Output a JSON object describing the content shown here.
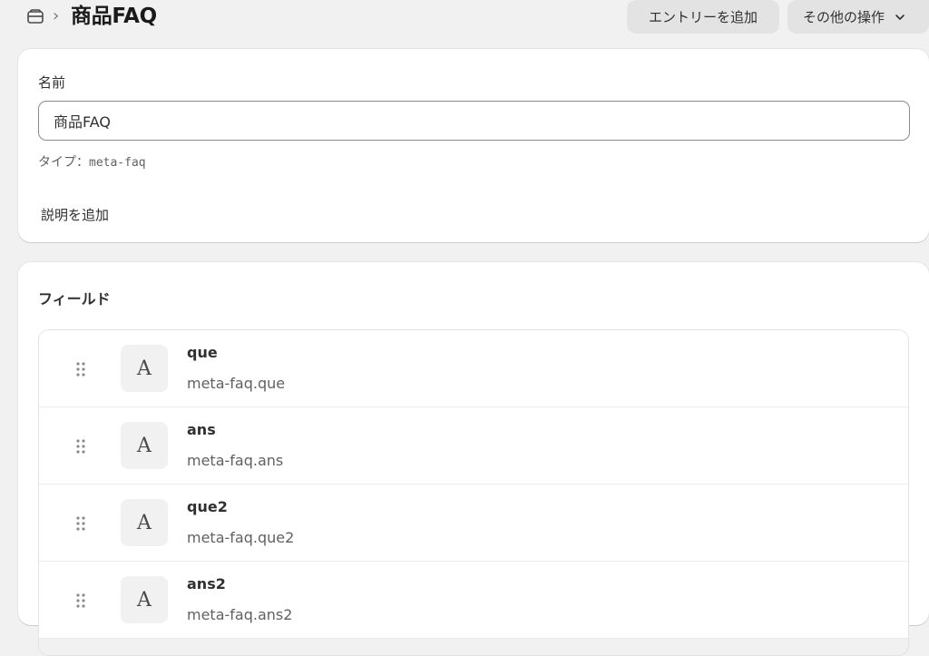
{
  "header": {
    "breadcrumb_icon": "metaobject-icon",
    "separator": "›",
    "title": "商品FAQ",
    "add_entry_label": "エントリーを追加",
    "more_actions_label": "その他の操作",
    "more_actions_icon": "chevron-down-icon"
  },
  "name_card": {
    "name_label": "名前",
    "name_value": "商品FAQ",
    "type_label": "タイプ：",
    "type_value": "meta-faq",
    "add_description_label": "説明を追加"
  },
  "fields_card": {
    "title": "フィールド",
    "fields": [
      {
        "name": "que",
        "key": "meta-faq.que",
        "type_icon": "A"
      },
      {
        "name": "ans",
        "key": "meta-faq.ans",
        "type_icon": "A"
      },
      {
        "name": "que2",
        "key": "meta-faq.que2",
        "type_icon": "A"
      },
      {
        "name": "ans2",
        "key": "meta-faq.ans2",
        "type_icon": "A"
      }
    ]
  },
  "colors": {
    "page_background": "#f1f1f1",
    "card_background": "#ffffff",
    "button_background": "#e3e3e3",
    "text_primary": "#303030",
    "text_secondary": "#616161"
  }
}
